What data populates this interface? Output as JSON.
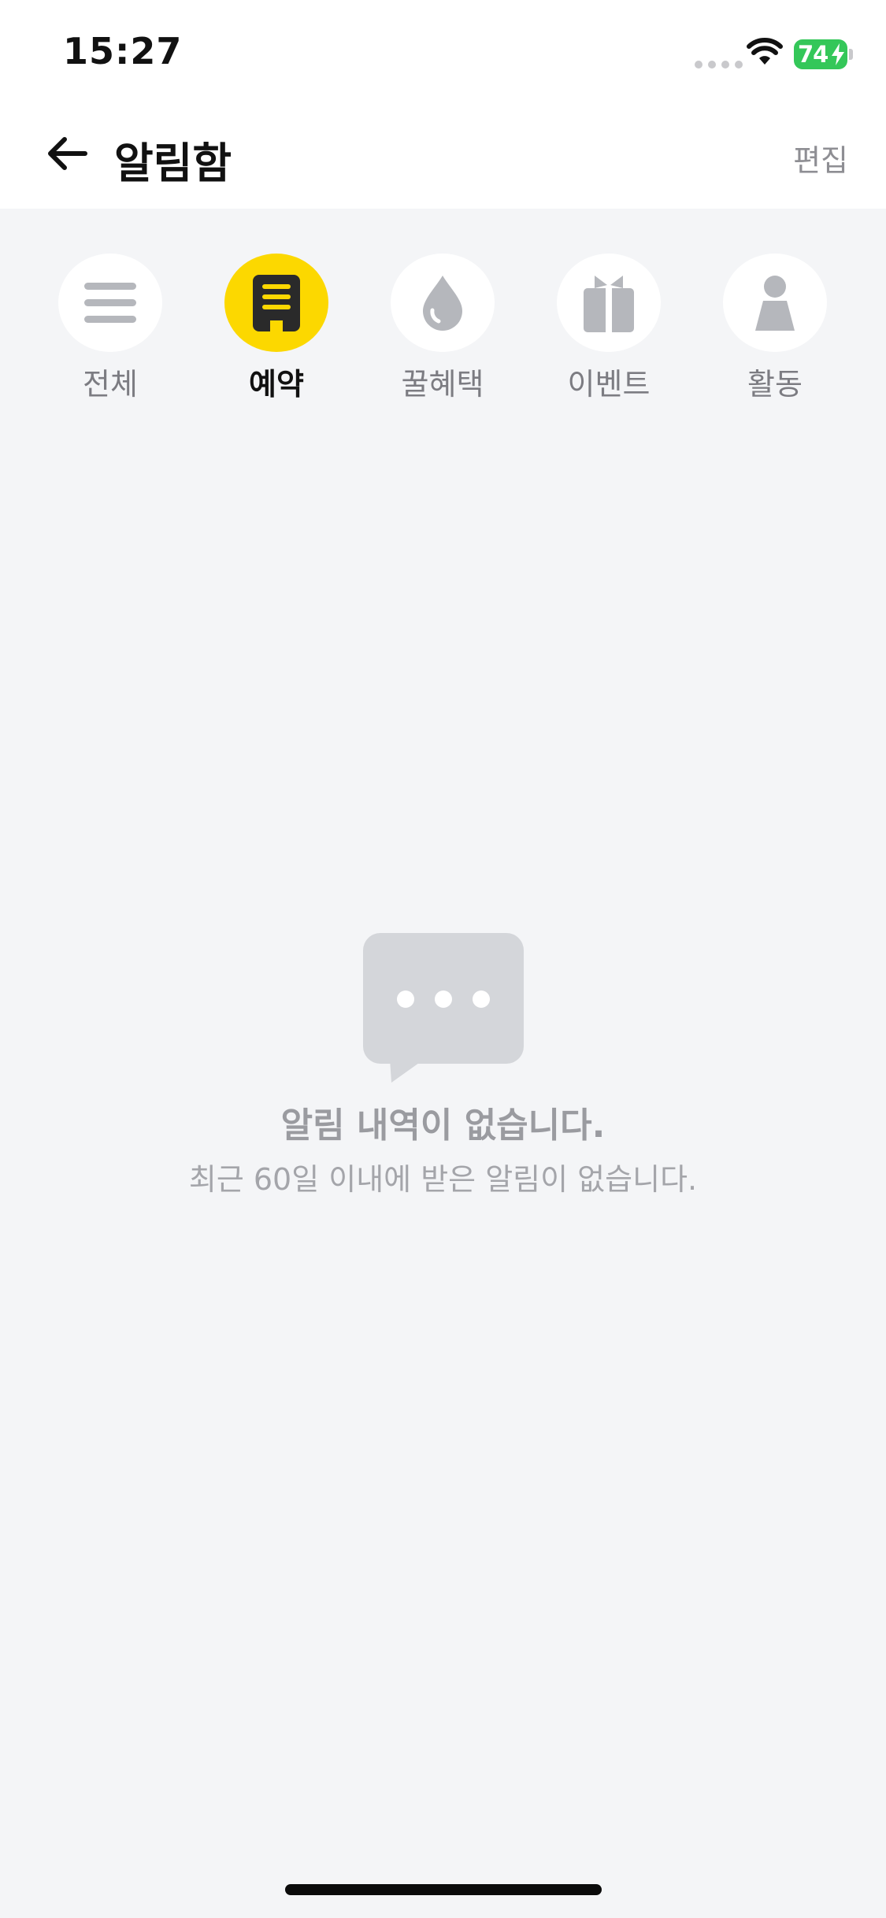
{
  "status_bar": {
    "time": "15:27",
    "battery_level": "74",
    "battery_color": "#34c759"
  },
  "header": {
    "title": "알림함",
    "edit_label": "편집",
    "back_icon": "arrow-left-icon"
  },
  "tabs": [
    {
      "label": "전체",
      "icon": "menu-lines-icon",
      "active": false
    },
    {
      "label": "예약",
      "icon": "receipt-icon",
      "active": true
    },
    {
      "label": "꿀혜택",
      "icon": "drop-icon",
      "active": false
    },
    {
      "label": "이벤트",
      "icon": "gift-icon",
      "active": false
    },
    {
      "label": "활동",
      "icon": "person-icon",
      "active": false
    }
  ],
  "empty_state": {
    "icon": "chat-bubble-icon",
    "title": "알림 내역이 없습니다.",
    "description": "최근 60일 이내에 받은 알림이 없습니다."
  },
  "colors": {
    "accent": "#fcd800",
    "background": "#f4f5f7",
    "icon_gray": "#b5b7bc"
  }
}
